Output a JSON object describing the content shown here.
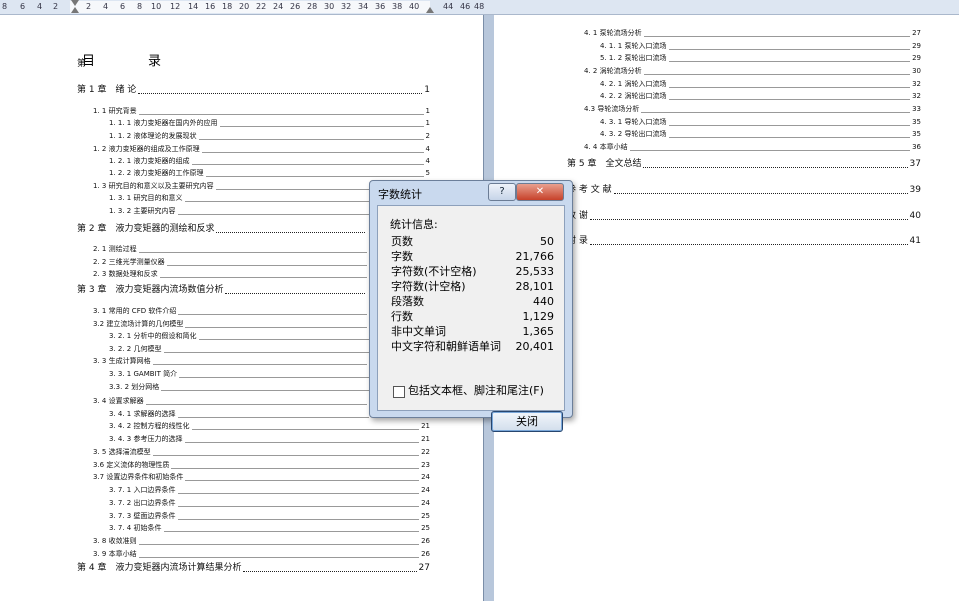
{
  "ruler": {
    "ticks": [
      "8",
      "6",
      "4",
      "2",
      "2",
      "4",
      "6",
      "8",
      "10",
      "12",
      "14",
      "16",
      "18",
      "20",
      "22",
      "24",
      "26",
      "28",
      "30",
      "32",
      "34",
      "36",
      "38",
      "40",
      "44",
      "46",
      "48"
    ]
  },
  "toc": {
    "heading": "目　录",
    "pre_entry": "第",
    "left": [
      {
        "level": "ch",
        "text": "第 1 章　绪  论",
        "page": "1"
      },
      {
        "level": "l2",
        "text": "1. 1 研究背景",
        "page": "1"
      },
      {
        "level": "l3",
        "text": "1. 1. 1 液力变矩器在国内外的应用",
        "page": "1"
      },
      {
        "level": "l3",
        "text": "1. 1. 2 液体理论的发展现状",
        "page": "2"
      },
      {
        "level": "l2",
        "text": "1. 2 液力变矩器的组成及工作原理",
        "page": "4"
      },
      {
        "level": "l3",
        "text": "1. 2. 1 液力变矩器的组成",
        "page": "4"
      },
      {
        "level": "l3",
        "text": "1. 2. 2 液力变矩器的工作原理",
        "page": "5"
      },
      {
        "level": "l2",
        "text": "1. 3 研究目的和意义以及主要研究内容",
        "page": ""
      },
      {
        "level": "l3",
        "text": "1. 3. 1 研究目的和意义",
        "page": ""
      },
      {
        "level": "l3",
        "text": "1. 3. 2 主要研究内容",
        "page": ""
      },
      {
        "level": "ch",
        "text": "第 2 章　液力变矩器的测绘和反求",
        "page": ""
      },
      {
        "level": "l2",
        "text": "2. 1 测绘过程",
        "page": ""
      },
      {
        "level": "l2",
        "text": "2. 2 三维光学测量仪器",
        "page": ""
      },
      {
        "level": "l2",
        "text": "2. 3 数据处理和反求",
        "page": ""
      },
      {
        "level": "ch",
        "text": "第 3 章　液力变矩器内流场数值分析",
        "page": ""
      },
      {
        "level": "l2",
        "text": "3. 1 常用的 CFD 软件介绍",
        "page": ""
      },
      {
        "level": "l2",
        "text": "3.2 建立流场计算的几何模型",
        "page": ""
      },
      {
        "level": "l3",
        "text": "3. 2. 1 分析中的假设和简化",
        "page": ""
      },
      {
        "level": "l3",
        "text": "3. 2. 2 几何模型",
        "page": ""
      },
      {
        "level": "l2",
        "text": "3. 3 生成计算网格",
        "page": ""
      },
      {
        "level": "l3",
        "text": "3. 3. 1 GAMBIT 简介",
        "page": ""
      },
      {
        "level": "l3",
        "text": "3.3. 2 划分网格",
        "page": ""
      },
      {
        "level": "l2",
        "text": "3. 4 设置求解器",
        "page": ""
      },
      {
        "level": "l3",
        "text": "3. 4. 1 求解器的选择",
        "page": ""
      },
      {
        "level": "l3",
        "text": "3. 4. 2 控制方程的线性化",
        "page": "21"
      },
      {
        "level": "l3",
        "text": "3. 4. 3 参考压力的选择",
        "page": "21"
      },
      {
        "level": "l2",
        "text": "3. 5 选择湍流模型",
        "page": "22"
      },
      {
        "level": "l2",
        "text": "3.6 定义流体的物理性质",
        "page": "23"
      },
      {
        "level": "l2",
        "text": "3.7 设置边界条件和初始条件",
        "page": "24"
      },
      {
        "level": "l3",
        "text": "3. 7. 1 入口边界条件",
        "page": "24"
      },
      {
        "level": "l3",
        "text": "3. 7. 2 出口边界条件",
        "page": "24"
      },
      {
        "level": "l3",
        "text": "3. 7. 3 壁面边界条件",
        "page": "25"
      },
      {
        "level": "l3",
        "text": "3. 7. 4 初始条件",
        "page": "25"
      },
      {
        "level": "l2",
        "text": "3. 8 收敛准则",
        "page": "26"
      },
      {
        "level": "l2",
        "text": "3. 9 本章小结",
        "page": "26"
      },
      {
        "level": "ch",
        "text": "第 4 章　液力变矩器内流场计算结果分析",
        "page": "27"
      }
    ],
    "right": [
      {
        "level": "l2",
        "text": "4. 1 泵轮流场分析",
        "page": "27"
      },
      {
        "level": "l3",
        "text": "4. 1. 1 泵轮入口流场",
        "page": "29"
      },
      {
        "level": "l3",
        "text": "5. 1. 2 泵轮出口流场",
        "page": "29"
      },
      {
        "level": "l2",
        "text": "4. 2 涡轮流场分析",
        "page": "30"
      },
      {
        "level": "l3",
        "text": "4. 2. 1 涡轮入口流场",
        "page": "32"
      },
      {
        "level": "l3",
        "text": "4. 2. 2 涡轮出口流场",
        "page": "32"
      },
      {
        "level": "l2",
        "text": "4.3 导轮流场分析",
        "page": "33"
      },
      {
        "level": "l3",
        "text": "4. 3. 1 导轮入口流场",
        "page": "35"
      },
      {
        "level": "l3",
        "text": "4. 3. 2 导轮出口流场",
        "page": "35"
      },
      {
        "level": "l2",
        "text": "4. 4 本章小结",
        "page": "36"
      },
      {
        "level": "ch",
        "text": "第 5 章　全文总结",
        "page": "37"
      },
      {
        "level": "ch",
        "text": "参 考 文 献",
        "page": "39"
      },
      {
        "level": "ch",
        "text": "致  谢",
        "page": "40"
      },
      {
        "level": "ch",
        "text": "附  录",
        "page": "41"
      }
    ]
  },
  "dialog": {
    "title": "字数统计",
    "help_label": "?",
    "close_label": "✕",
    "group_label": "统计信息:",
    "stats": [
      {
        "label": "页数",
        "value": "50"
      },
      {
        "label": "字数",
        "value": "21,766"
      },
      {
        "label": "字符数(不计空格)",
        "value": "25,533"
      },
      {
        "label": "字符数(计空格)",
        "value": "28,101"
      },
      {
        "label": "段落数",
        "value": "440"
      },
      {
        "label": "行数",
        "value": "1,129"
      },
      {
        "label": "非中文单词",
        "value": "1,365"
      },
      {
        "label": "中文字符和朝鲜语单词",
        "value": "20,401"
      }
    ],
    "checkbox_label": "包括文本框、脚注和尾注(F)",
    "checkbox_checked": false,
    "ok_label": "关闭"
  }
}
